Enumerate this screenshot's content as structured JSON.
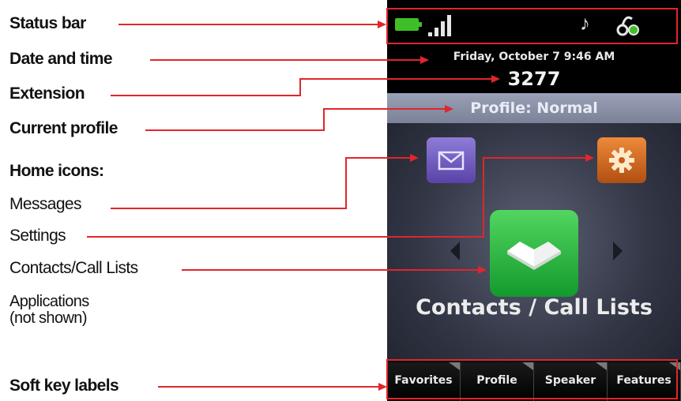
{
  "labels": {
    "status_bar": "Status bar",
    "date_time": "Date and time",
    "extension": "Extension",
    "current_profile": "Current profile",
    "home_icons": "Home icons:",
    "messages": "Messages",
    "settings": "Settings",
    "contacts_call_lists": "Contacts/Call Lists",
    "applications_line1": "Applications",
    "applications_line2": "(not shown)",
    "soft_key_labels": "Soft key labels"
  },
  "phone": {
    "date_time": "Friday, October 7 9:46 AM",
    "extension": "3277",
    "profile": "Profile: Normal",
    "home_label": "Contacts / Call Lists",
    "status_icons": [
      "battery-icon",
      "signal-strength-icon",
      "ringtone-note-icon",
      "bluetooth-headset-icon"
    ],
    "home_icons": [
      "messages-envelope-icon",
      "settings-gear-icon",
      "contacts-book-icon"
    ],
    "softkeys": [
      "Favorites",
      "Profile",
      "Speaker",
      "Features"
    ]
  },
  "colors": {
    "leader_line": "#e0262b",
    "battery": "#3fbf27",
    "messages_tile": "#6f5bc2",
    "settings_tile": "#d9702a",
    "contacts_tile": "#2fbf45"
  }
}
